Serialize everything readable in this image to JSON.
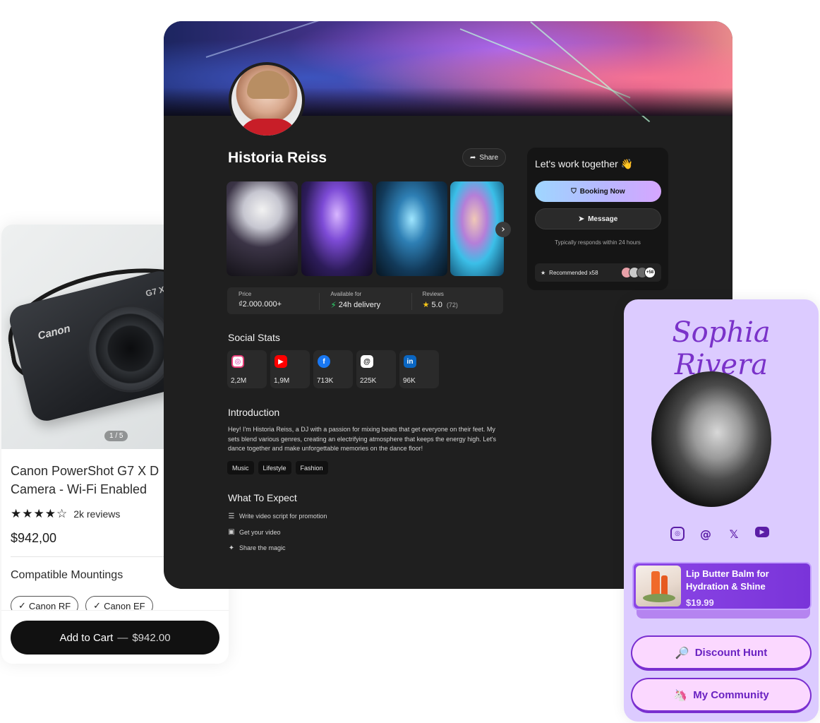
{
  "product": {
    "image_counter": "1 / 5",
    "camera_brand": "Canon",
    "camera_model": "G7 X",
    "title": "Canon PowerShot G7 X D\nCamera - Wi-Fi Enabled",
    "stars": "★★★★☆",
    "review_count": "2k reviews",
    "price": "$942,00",
    "mountings_label": "Compatible Mountings",
    "mountings": [
      "Canon RF",
      "Canon EF"
    ],
    "cart_label": "Add to Cart",
    "cart_separator": "—",
    "cart_amount": "$942.00"
  },
  "profile": {
    "name": "Historia Reiss",
    "share_label": "Share",
    "info": {
      "price_label": "Price",
      "price_value": "₫2.000.000+",
      "delivery_label": "Available for",
      "delivery_value": "24h delivery",
      "reviews_label": "Reviews",
      "reviews_value": "5.0",
      "reviews_count": "(72)"
    },
    "social_title": "Social Stats",
    "social": [
      {
        "platform": "instagram",
        "icon": "instagram-icon",
        "glyph": "◎",
        "value": "2,2M"
      },
      {
        "platform": "youtube",
        "icon": "youtube-icon",
        "glyph": "▶",
        "value": "1,9M"
      },
      {
        "platform": "facebook",
        "icon": "facebook-icon",
        "glyph": "f",
        "value": "713K"
      },
      {
        "platform": "threads",
        "icon": "threads-icon",
        "glyph": "@",
        "value": "225K"
      },
      {
        "platform": "linkedin",
        "icon": "linkedin-icon",
        "glyph": "in",
        "value": "96K"
      }
    ],
    "intro_title": "Introduction",
    "intro_text": "Hey! I'm Historia Reiss, a DJ with a passion for mixing beats that get everyone on their feet. My sets blend various genres, creating an electrifying atmosphere that keeps the energy high. Let's dance together and make unforgettable memories on the dance floor!",
    "tags": [
      "Music",
      "Lifestyle",
      "Fashion"
    ],
    "expect_title": "What To Expect",
    "expect": [
      {
        "icon": "checklist-icon",
        "glyph": "☰",
        "text": "Write video script for promotion"
      },
      {
        "icon": "video-icon",
        "glyph": "▣",
        "text": "Get your video"
      },
      {
        "icon": "party-icon",
        "glyph": "✦",
        "text": "Share the magic"
      }
    ],
    "work": {
      "title": "Let's work together 👋",
      "booking_label": "Booking Now",
      "message_label": "Message",
      "response_note": "Typically responds within 24 hours",
      "recommended_label": "Recommended x58",
      "recommended_more": "+58"
    }
  },
  "bio": {
    "name": "Sophia\nRivera",
    "product_title": "Lip Butter Balm for Hydration & Shine",
    "product_price": "$19.99",
    "links": [
      {
        "emoji": "🔎",
        "label": "Discount Hunt"
      },
      {
        "emoji": "🦄",
        "label": "My Community"
      }
    ]
  },
  "colors": {
    "profile_bg": "#1f1f1f",
    "bio_bg": "#dccbff",
    "bio_accent": "#7a32c9",
    "booking_gradient_start": "#9fd6ff",
    "booking_gradient_end": "#d6a6ff",
    "delivery_green": "#2fd36b",
    "star_yellow": "#f5c518"
  }
}
